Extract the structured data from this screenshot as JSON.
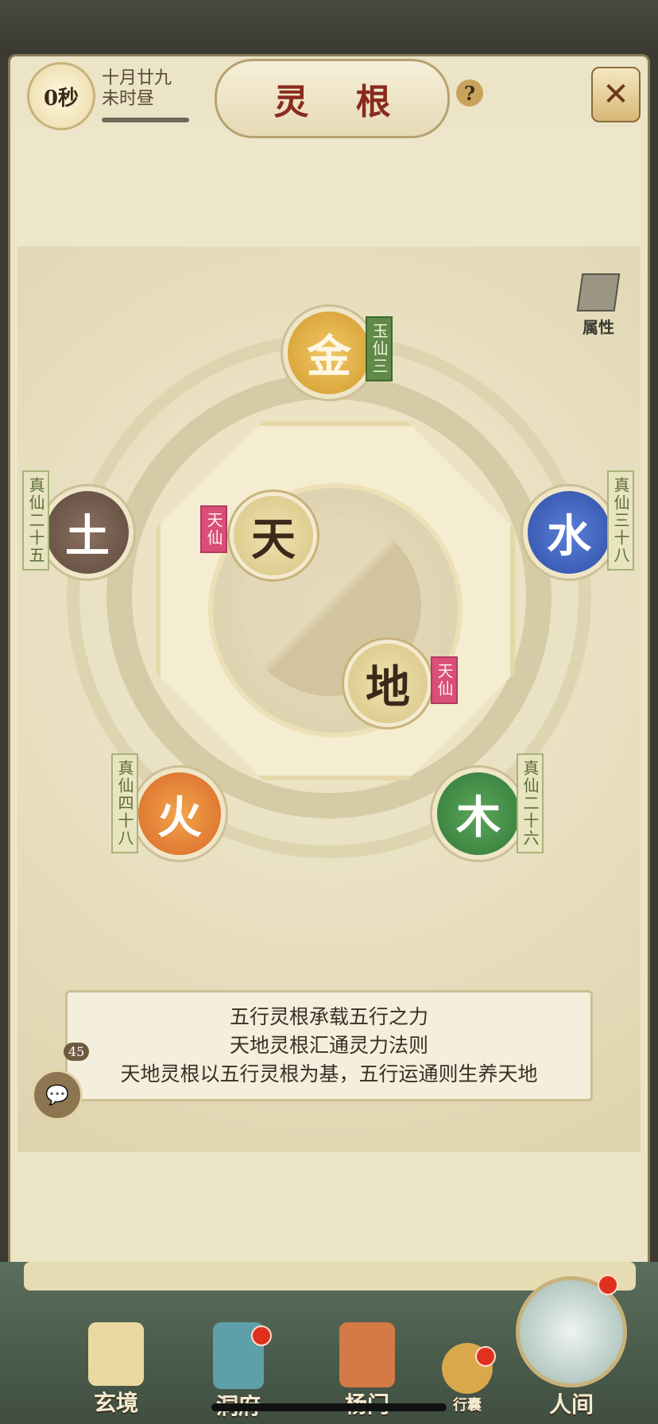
{
  "header": {
    "timer": "0秒",
    "date_line1": "十月廿九",
    "date_line2": "未时昼",
    "title": "灵 根",
    "help": "?",
    "close": "✕"
  },
  "attributes_button": "属性",
  "elements": {
    "jin": {
      "char": "金",
      "rank": "玉仙三"
    },
    "tu": {
      "char": "土",
      "rank": "真仙二十五"
    },
    "shui": {
      "char": "水",
      "rank": "真仙三十八"
    },
    "huo": {
      "char": "火",
      "rank": "真仙四十八"
    },
    "mu": {
      "char": "木",
      "rank": "真仙二十六"
    },
    "tian": {
      "char": "天",
      "rank": "天仙"
    },
    "di": {
      "char": "地",
      "rank": "天仙"
    }
  },
  "description": {
    "line1": "五行灵根承载五行之力",
    "line2": "天地灵根汇通灵力法则",
    "line3": "天地灵根以五行灵根为基，五行运通则生养天地"
  },
  "chat": {
    "count": "45"
  },
  "nav": {
    "xuanjing": "玄境",
    "dongfu": "洞府",
    "yangmen": "杨门",
    "xingnang": "行囊",
    "renjian": "人间"
  }
}
